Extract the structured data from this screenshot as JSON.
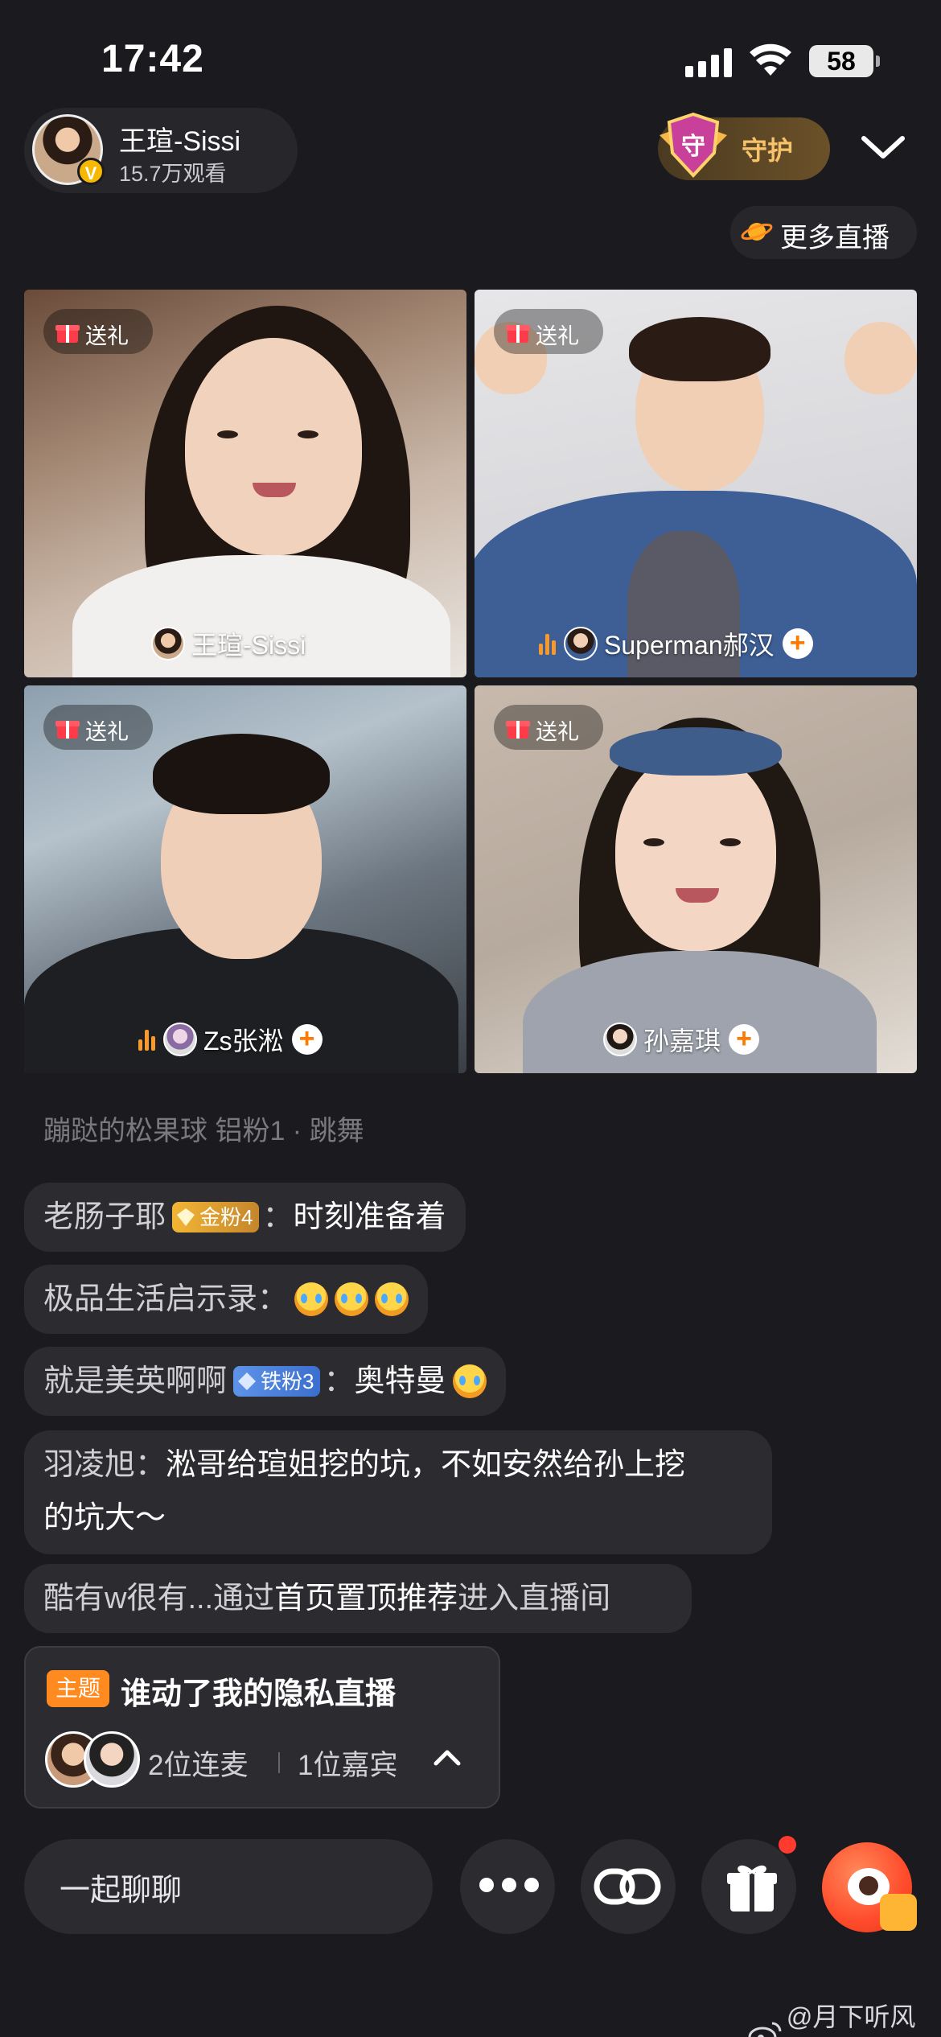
{
  "status_bar": {
    "time": "17:42",
    "battery": "58"
  },
  "host": {
    "name": "王瑄-Sissi",
    "views": "15.7万观看",
    "verified_icon": "v-badge-icon"
  },
  "guard_button": {
    "label": "守护",
    "badge_char": "守"
  },
  "more_live": {
    "label": "更多直播"
  },
  "tiles": [
    {
      "gift_label": "送礼",
      "name": "王瑄-Sissi",
      "speaking": false,
      "follow": false
    },
    {
      "gift_label": "送礼",
      "name": "Superman郝汉",
      "speaking": true,
      "follow": true
    },
    {
      "gift_label": "送礼",
      "name": "Zs张淞",
      "speaking": true,
      "follow": true
    },
    {
      "gift_label": "送礼",
      "name": "孙嘉琪",
      "speaking": false,
      "follow": true
    }
  ],
  "chat": {
    "faded": "蹦跶的松果球 铝粉1 · 跳舞",
    "messages": [
      {
        "user": "老肠子耶",
        "badge": "金粉4",
        "badge_type": "gold",
        "content": "时刻准备着",
        "emojis": 0
      },
      {
        "user": "极品生活启示录",
        "badge": "",
        "content": "",
        "emojis": 3
      },
      {
        "user": "就是美英啊啊",
        "badge": "铁粉3",
        "badge_type": "iron",
        "content": "奥特曼",
        "emojis": 1
      }
    ],
    "long_message": {
      "user": "羽凌旭",
      "content_line1": "淞哥给瑄姐挖的坑，不如安然给孙上挖",
      "content_line2": "的坑大～"
    },
    "system_message": {
      "user": "酷有w很有...",
      "pre": "通过",
      "highlight": "首页置顶推荐",
      "post": "进入直播间"
    }
  },
  "topic": {
    "tag": "主题",
    "title": "谁动了我的隐私直播",
    "connected": "2位连麦",
    "guests": "1位嘉宾"
  },
  "bottom_bar": {
    "input_placeholder": "一起聊聊"
  },
  "watermark": {
    "text": "@月下听风儿"
  },
  "colors": {
    "background": "#1b1b1f",
    "accent_orange": "#ff8a1f",
    "gold_text": "#f7c36a"
  }
}
